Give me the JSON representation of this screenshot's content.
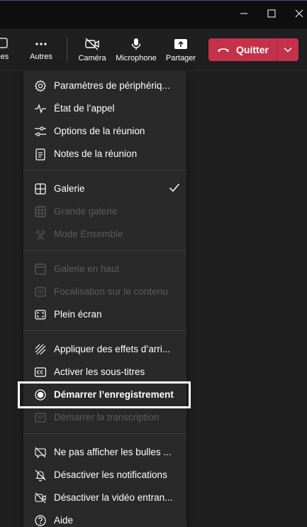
{
  "colors": {
    "background": "#1f1f1f",
    "menu_background": "#292929",
    "quit_button": "#c4314b",
    "disabled_text": "#5c5c5c"
  },
  "toolbar": {
    "bulles_label": "lles",
    "autres_label": "Autres",
    "camera_label": "Caméra",
    "microphone_label": "Microphone",
    "share_label": "Partager",
    "quit_label": "Quitter"
  },
  "menu": {
    "items": [
      {
        "label": "Paramètres de périphériq...",
        "icon": "gear-icon",
        "disabled": false
      },
      {
        "label": "État de l’appel",
        "icon": "pulse-icon",
        "disabled": false
      },
      {
        "label": "Options de la réunion",
        "icon": "sliders-icon",
        "disabled": false
      },
      {
        "label": "Notes de la réunion",
        "icon": "notes-icon",
        "disabled": false
      },
      {
        "label": "Galerie",
        "icon": "grid-icon",
        "disabled": false,
        "checked": true
      },
      {
        "label": "Grande galerie",
        "icon": "large-grid-icon",
        "disabled": true
      },
      {
        "label": "Mode Ensemble",
        "icon": "people-icon",
        "disabled": true
      },
      {
        "label": "Galerie en haut",
        "icon": "gallery-top-icon",
        "disabled": true
      },
      {
        "label": "Focalisation sur le contenu",
        "icon": "content-focus-icon",
        "disabled": true
      },
      {
        "label": "Plein écran",
        "icon": "fullscreen-icon",
        "disabled": false
      },
      {
        "label": "Appliquer des effets d’arri...",
        "icon": "background-effects-icon",
        "disabled": false
      },
      {
        "label": "Activer les sous-titres",
        "icon": "captions-icon",
        "disabled": false
      },
      {
        "label": "Démarrer l’enregistrement",
        "icon": "record-icon",
        "disabled": false,
        "highlighted": true
      },
      {
        "label": "Démarrer la transcription",
        "icon": "transcript-icon",
        "disabled": true
      },
      {
        "label": "Ne pas afficher les bulles ...",
        "icon": "chat-bubble-off-icon",
        "disabled": false
      },
      {
        "label": "Désactiver les notifications",
        "icon": "bell-off-icon",
        "disabled": false
      },
      {
        "label": "Désactiver la vidéo entran...",
        "icon": "video-off-icon",
        "disabled": false
      },
      {
        "label": "Aide",
        "icon": "help-icon",
        "disabled": false
      }
    ]
  }
}
